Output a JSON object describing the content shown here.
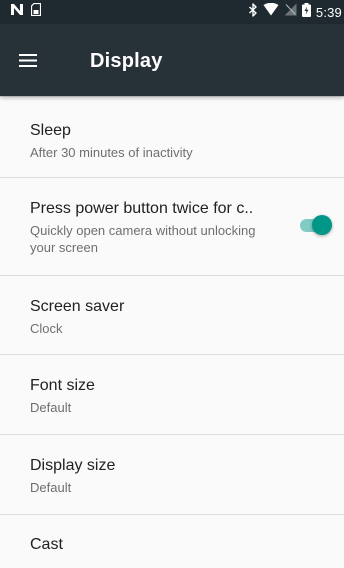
{
  "status_bar": {
    "time": "5:39",
    "icons": [
      "notification-n-icon",
      "sd-card-icon",
      "bluetooth-icon",
      "wifi-icon",
      "no-signal-icon",
      "battery-icon"
    ]
  },
  "app_bar": {
    "menu_icon": "menu-icon",
    "title": "Display"
  },
  "settings": [
    {
      "title": "Sleep",
      "summary": "After 30 minutes of inactivity"
    },
    {
      "title": "Press power button twice for c..",
      "summary": "Quickly open camera without unlocking your screen",
      "toggle": true,
      "toggle_state": "on"
    },
    {
      "title": "Screen saver",
      "summary": "Clock"
    },
    {
      "title": "Font size",
      "summary": "Default"
    },
    {
      "title": "Display size",
      "summary": "Default"
    },
    {
      "title": "Cast"
    }
  ],
  "colors": {
    "status_bar": "#1f2a30",
    "app_bar": "#263238",
    "background": "#fafafa",
    "accent": "#009688",
    "accent_track": "#80cbc4",
    "divider": "#dcdcdc"
  }
}
